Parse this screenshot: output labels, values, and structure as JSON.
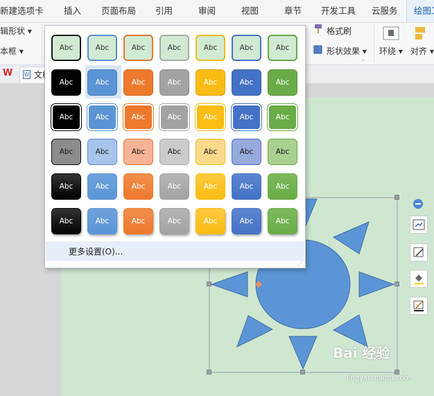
{
  "menu": {
    "tabs": [
      "新建选项卡",
      "插入",
      "页面布局",
      "引用",
      "审阅",
      "视图",
      "章节",
      "开发工具",
      "云服务",
      "绘图工"
    ],
    "active_tab": "绘图工"
  },
  "ribbon": {
    "left_top": "辑形状 ▾",
    "left_bottom": "本框 ▾",
    "format_painter": "格式刷",
    "shape_effects": "形状效果 ▾",
    "wrap": "环绕 ▾",
    "align": "对齐 ▾"
  },
  "docbar": {
    "logo": "W",
    "doc_label": "文档"
  },
  "style_gallery": {
    "swatch_label": "Abc",
    "rows": [
      {
        "style": "outline",
        "fills": [
          "#d1ead3",
          "#d1ead3",
          "#d1ead3",
          "#d1ead3",
          "#d1ead3",
          "#d1ead3",
          "#d1ead3"
        ],
        "borders": [
          "#1a1a1a",
          "#5b8fd2",
          "#e17a30",
          "#a9a9a9",
          "#f5bd1c",
          "#4872c6",
          "#67a84b"
        ],
        "text": "#333333"
      },
      {
        "style": "solid",
        "fills": [
          "#000000",
          "#5b95d5",
          "#ee7a2d",
          "#a3a3a3",
          "#fbbd13",
          "#4472c6",
          "#6aac47"
        ],
        "borders": [
          "#000000",
          "#4a7fbf",
          "#cf6722",
          "#8d8d8d",
          "#d9a20b",
          "#3860a8",
          "#57903a"
        ],
        "text": "#ffffff"
      },
      {
        "style": "light-border",
        "fills": [
          "#000000",
          "#5b95d5",
          "#ee7a2d",
          "#a3a3a3",
          "#fbbd13",
          "#4472c6",
          "#6aac47"
        ],
        "borders": [
          "#ffffff",
          "#ffffff",
          "#ffffff",
          "#ffffff",
          "#ffffff",
          "#ffffff",
          "#ffffff"
        ],
        "text": "#ffffff"
      },
      {
        "style": "tinted",
        "fills": [
          "#8c8c8c",
          "#a7c4ea",
          "#f6b396",
          "#cbcbcb",
          "#fdd98c",
          "#98a9dc",
          "#a9d08e"
        ],
        "borders": [
          "#111111",
          "#5b8fd2",
          "#e17a30",
          "#a9a9a9",
          "#f5bd1c",
          "#4872c6",
          "#67a84b"
        ],
        "text": "#1a1a1a"
      },
      {
        "style": "gradient",
        "fills": [
          "#000000",
          "#5b95d5",
          "#ee7a2d",
          "#a3a3a3",
          "#fbbd13",
          "#4472c6",
          "#6aac47"
        ],
        "borders": [
          "#333333",
          "#6fa2db",
          "#f08e4d",
          "#b5b5b5",
          "#fcc93e",
          "#5c86d1",
          "#7cba5c"
        ],
        "text": "#ffffff"
      },
      {
        "style": "gradient-shadow",
        "fills": [
          "#000000",
          "#5b95d5",
          "#ee7a2d",
          "#a3a3a3",
          "#fbbd13",
          "#4472c6",
          "#6aac47"
        ],
        "borders": [
          "#333333",
          "#6fa2db",
          "#f08e4d",
          "#b5b5b5",
          "#fcc93e",
          "#5c86d1",
          "#7cba5c"
        ],
        "text": "#ffffff"
      }
    ],
    "more_settings": "更多设置(O)..."
  },
  "colors": {
    "page_green": "#cfe7d0",
    "sun_blue": "#5b95d5",
    "sun_stroke": "#3f6fa6"
  },
  "watermark": {
    "brand": "Bai 经验",
    "url": "jingyan.baidu.com"
  }
}
